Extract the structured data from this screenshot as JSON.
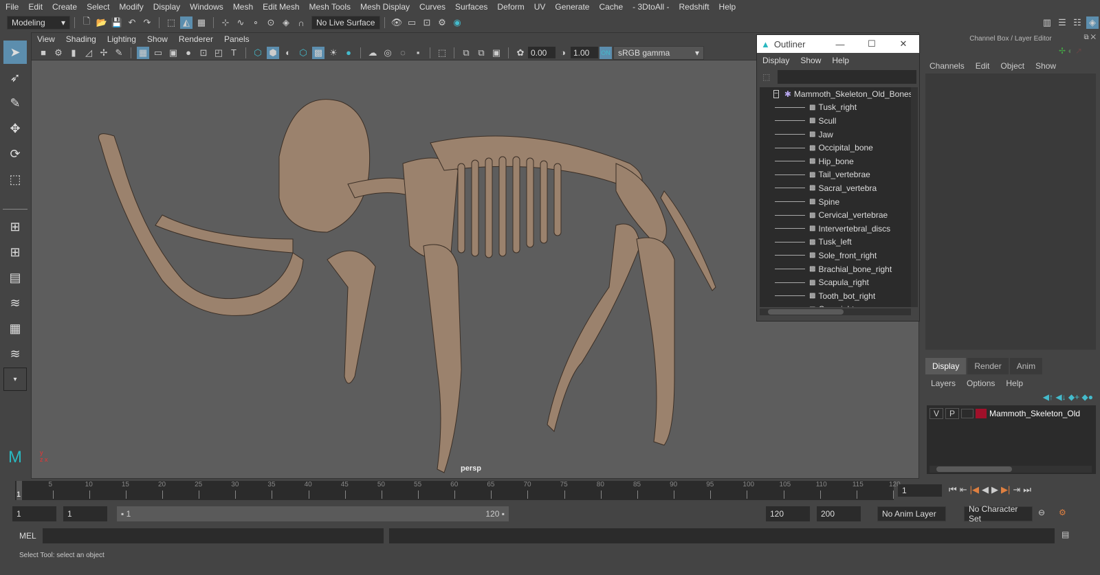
{
  "menubar": [
    "File",
    "Edit",
    "Create",
    "Select",
    "Modify",
    "Display",
    "Windows",
    "Mesh",
    "Edit Mesh",
    "Mesh Tools",
    "Mesh Display",
    "Curves",
    "Surfaces",
    "Deform",
    "UV",
    "Generate",
    "Cache",
    "- 3DtoAll -",
    "Redshift",
    "Help"
  ],
  "shelf": {
    "workspace": "Modeling",
    "live_surface": "No Live Surface"
  },
  "viewport": {
    "menu": [
      "View",
      "Shading",
      "Lighting",
      "Show",
      "Renderer",
      "Panels"
    ],
    "exposure": "0.00",
    "gamma": "1.00",
    "color_space": "sRGB gamma",
    "camera": "persp"
  },
  "outliner": {
    "title": "Outliner",
    "menu": [
      "Display",
      "Show",
      "Help"
    ],
    "root": "Mammoth_Skeleton_Old_Bones",
    "items": [
      "Tusk_right",
      "Scull",
      "Jaw",
      "Occipital_bone",
      "Hip_bone",
      "Tail_vertebrae",
      "Sacral_vertebra",
      "Spine",
      "Cervical_vertebrae",
      "Intervertebral_discs",
      "Tusk_left",
      "Sole_front_right",
      "Brachial_bone_right",
      "Scapula_right",
      "Tooth_bot_right",
      "Cup_right"
    ]
  },
  "channel_box": {
    "title": "Channel Box / Layer Editor",
    "menu": [
      "Channels",
      "Edit",
      "Object",
      "Show"
    ]
  },
  "layer_editor": {
    "tabs": [
      "Display",
      "Render",
      "Anim"
    ],
    "menu": [
      "Layers",
      "Options",
      "Help"
    ],
    "layer": {
      "v": "V",
      "p": "P",
      "name": "Mammoth_Skeleton_Old",
      "color": "#a0102a"
    }
  },
  "timeline": {
    "ticks": [
      "5",
      "10",
      "15",
      "20",
      "25",
      "30",
      "35",
      "40",
      "45",
      "50",
      "55",
      "60",
      "65",
      "70",
      "75",
      "80",
      "85",
      "90",
      "95",
      "100",
      "105",
      "110",
      "115",
      "120"
    ],
    "current": "1",
    "current_field": "1"
  },
  "range": {
    "start": "1",
    "playback_start": "1",
    "slider_start": "1",
    "slider_end": "120",
    "playback_end": "120",
    "end": "200",
    "anim_layer": "No Anim Layer",
    "character_set": "No Character Set"
  },
  "mel": {
    "label": "MEL"
  },
  "status": {
    "text": "Select Tool: select an object"
  }
}
